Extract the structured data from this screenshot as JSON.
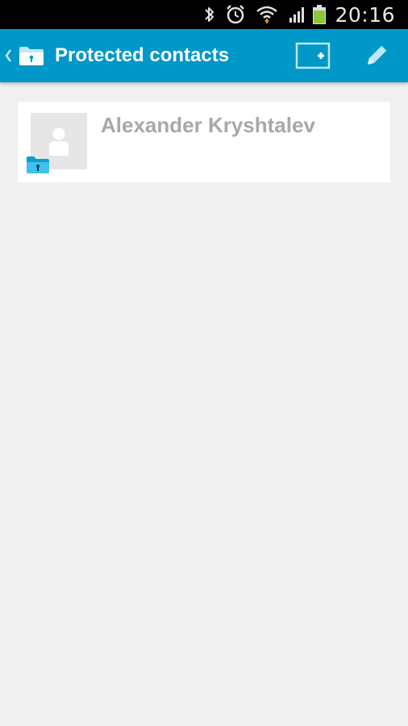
{
  "status_bar": {
    "time": "20:16",
    "icons": [
      "bluetooth-icon",
      "alarm-icon",
      "wifi-icon",
      "signal-icon",
      "battery-icon"
    ],
    "battery_color": "#8cc63f"
  },
  "action_bar": {
    "title": "Protected contacts",
    "background_color": "#0097c9",
    "actions": [
      "add-contact-icon",
      "edit-icon"
    ]
  },
  "contacts": [
    {
      "name": "Alexander Kryshtalev",
      "protected": true
    }
  ],
  "colors": {
    "accent": "#0097c9",
    "folder_icon": "#29b6e8",
    "background": "#f0f0f0"
  }
}
